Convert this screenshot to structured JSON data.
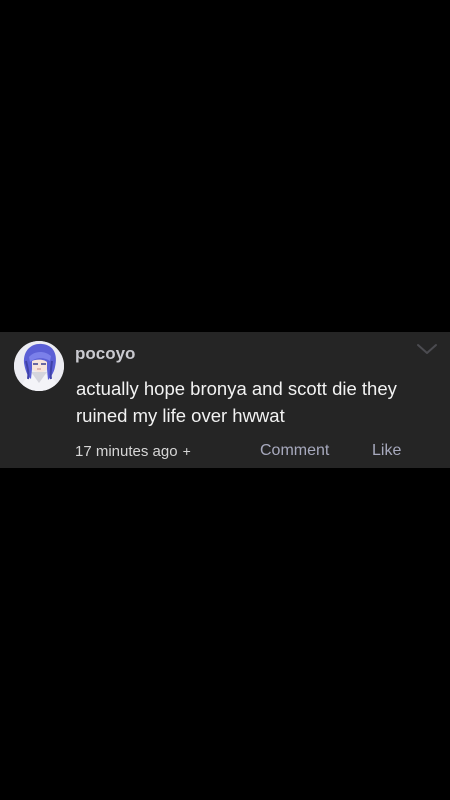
{
  "comment": {
    "username": "pocoyo",
    "text": "actually hope bronya and scott die they ruined my life over hwwat",
    "timestamp": "17 minutes ago",
    "expand_symbol": "+",
    "actions": {
      "comment_label": "Comment",
      "like_label": "Like"
    },
    "icons": {
      "avatar": "anime-avatar-image",
      "options": "chevron-down-icon"
    }
  },
  "colors": {
    "background": "#000000",
    "card": "#252525",
    "username": "#c9c9cf",
    "text": "#f2f2f2",
    "action": "#a7a9bd"
  }
}
